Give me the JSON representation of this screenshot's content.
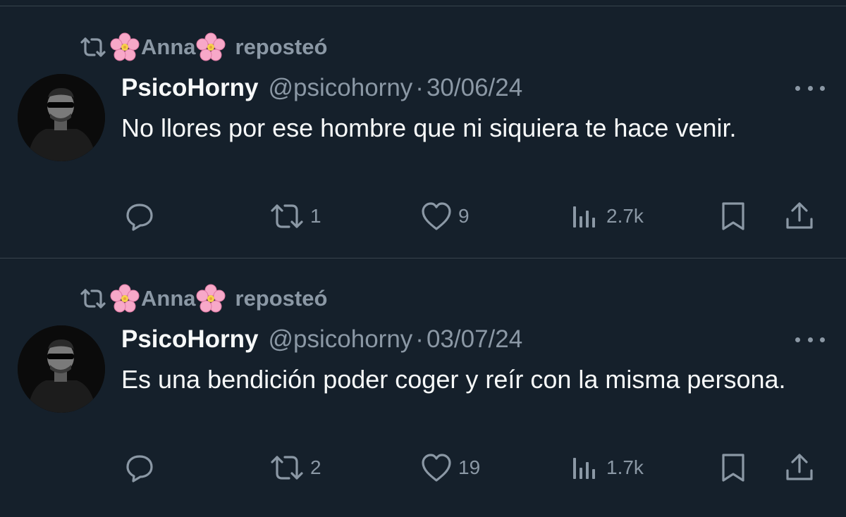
{
  "tweets": [
    {
      "reposter_name": "Anna",
      "repost_label": "reposteó",
      "author_name": "PsicoHorny",
      "handle": "@psicohorny",
      "separator": "·",
      "date": "30/06/24",
      "text": "No llores por ese hombre que ni siquiera te hace venir.",
      "retweets": "1",
      "likes": "9",
      "views": "2.7k"
    },
    {
      "reposter_name": "Anna",
      "repost_label": "reposteó",
      "author_name": "PsicoHorny",
      "handle": "@psicohorny",
      "separator": "·",
      "date": "03/07/24",
      "text": "Es una bendición poder coger y reír con la misma persona.",
      "retweets": "2",
      "likes": "19",
      "views": "1.7k"
    }
  ],
  "icons": {
    "repost": "repost-icon",
    "flower": "cherry-blossom-icon",
    "more": "more-icon",
    "reply": "reply-icon",
    "retweet": "retweet-icon",
    "like": "heart-icon",
    "views": "views-icon",
    "bookmark": "bookmark-icon",
    "share": "share-icon"
  },
  "colors": {
    "background": "#15202b",
    "text_primary": "#f7f9f9",
    "text_secondary": "#8b98a5",
    "divider": "#38444d",
    "flower_pink": "#f7a8c8"
  }
}
